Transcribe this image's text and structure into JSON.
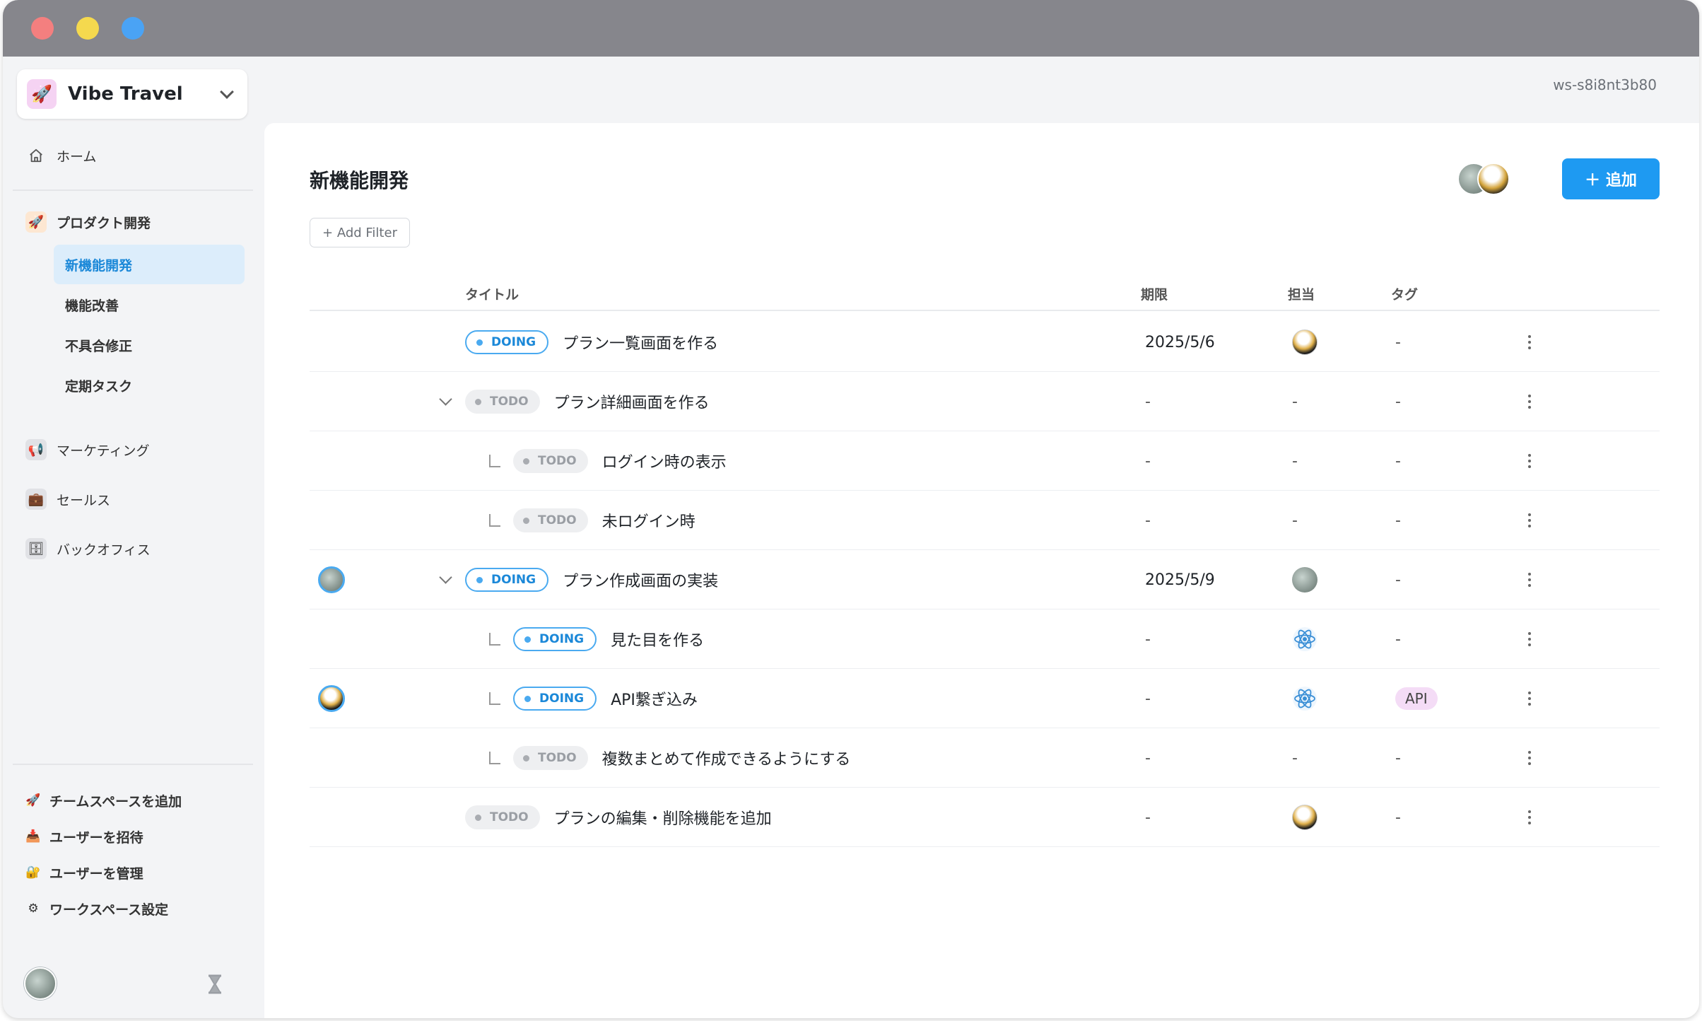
{
  "workspace": {
    "name": "Vibe Travel",
    "id": "ws-s8i8nt3b80"
  },
  "sidebar": {
    "home_label": "ホーム",
    "groups": [
      {
        "label": "プロダクト開発",
        "icon": "rocket-icon"
      },
      {
        "label": "マーケティング",
        "icon": "megaphone-icon"
      },
      {
        "label": "セールス",
        "icon": "briefcase-icon"
      },
      {
        "label": "バックオフィス",
        "icon": "cabinet-icon"
      }
    ],
    "sub_items": [
      {
        "label": "新機能開発",
        "active": true
      },
      {
        "label": "機能改善",
        "active": false
      },
      {
        "label": "不具合修正",
        "active": false
      },
      {
        "label": "定期タスク",
        "active": false
      }
    ],
    "bottom": [
      {
        "label": "チームスペースを追加",
        "icon": "rocket-icon"
      },
      {
        "label": "ユーザーを招待",
        "icon": "inbox-icon"
      },
      {
        "label": "ユーザーを管理",
        "icon": "lock-icon"
      },
      {
        "label": "ワークスペース設定",
        "icon": "gear-icon"
      }
    ]
  },
  "main": {
    "title": "新機能開発",
    "add_filter_label": "+ Add Filter",
    "add_button_label": "＋ 追加",
    "columns": {
      "title": "タイトル",
      "due": "期限",
      "assignee": "担当",
      "tag": "タグ"
    },
    "tasks": [
      {
        "status": "DOING",
        "title": "プラン一覧画面を作る",
        "due": "2025/5/6",
        "assignee": "mono",
        "tag": "-"
      },
      {
        "status": "TODO",
        "title": "プラン詳細画面を作る",
        "due": "-",
        "assignee": "-",
        "tag": "-"
      },
      {
        "status": "TODO",
        "title": "ログイン時の表示",
        "due": "-",
        "assignee": "-",
        "tag": "-"
      },
      {
        "status": "TODO",
        "title": "未ログイン時",
        "due": "-",
        "assignee": "-",
        "tag": "-"
      },
      {
        "status": "DOING",
        "title": "プラン作成画面の実装",
        "due": "2025/5/9",
        "assignee": "photo",
        "tag": "-"
      },
      {
        "status": "DOING",
        "title": "見た目を作る",
        "due": "-",
        "assignee": "ai",
        "tag": "-"
      },
      {
        "status": "DOING",
        "title": "API繋ぎ込み",
        "due": "-",
        "assignee": "ai",
        "tag": "API"
      },
      {
        "status": "TODO",
        "title": "複数まとめて作成できるようにする",
        "due": "-",
        "assignee": "-",
        "tag": "-"
      },
      {
        "status": "TODO",
        "title": "プランの編集・削除機能を追加",
        "due": "-",
        "assignee": "mono",
        "tag": "-"
      }
    ]
  }
}
